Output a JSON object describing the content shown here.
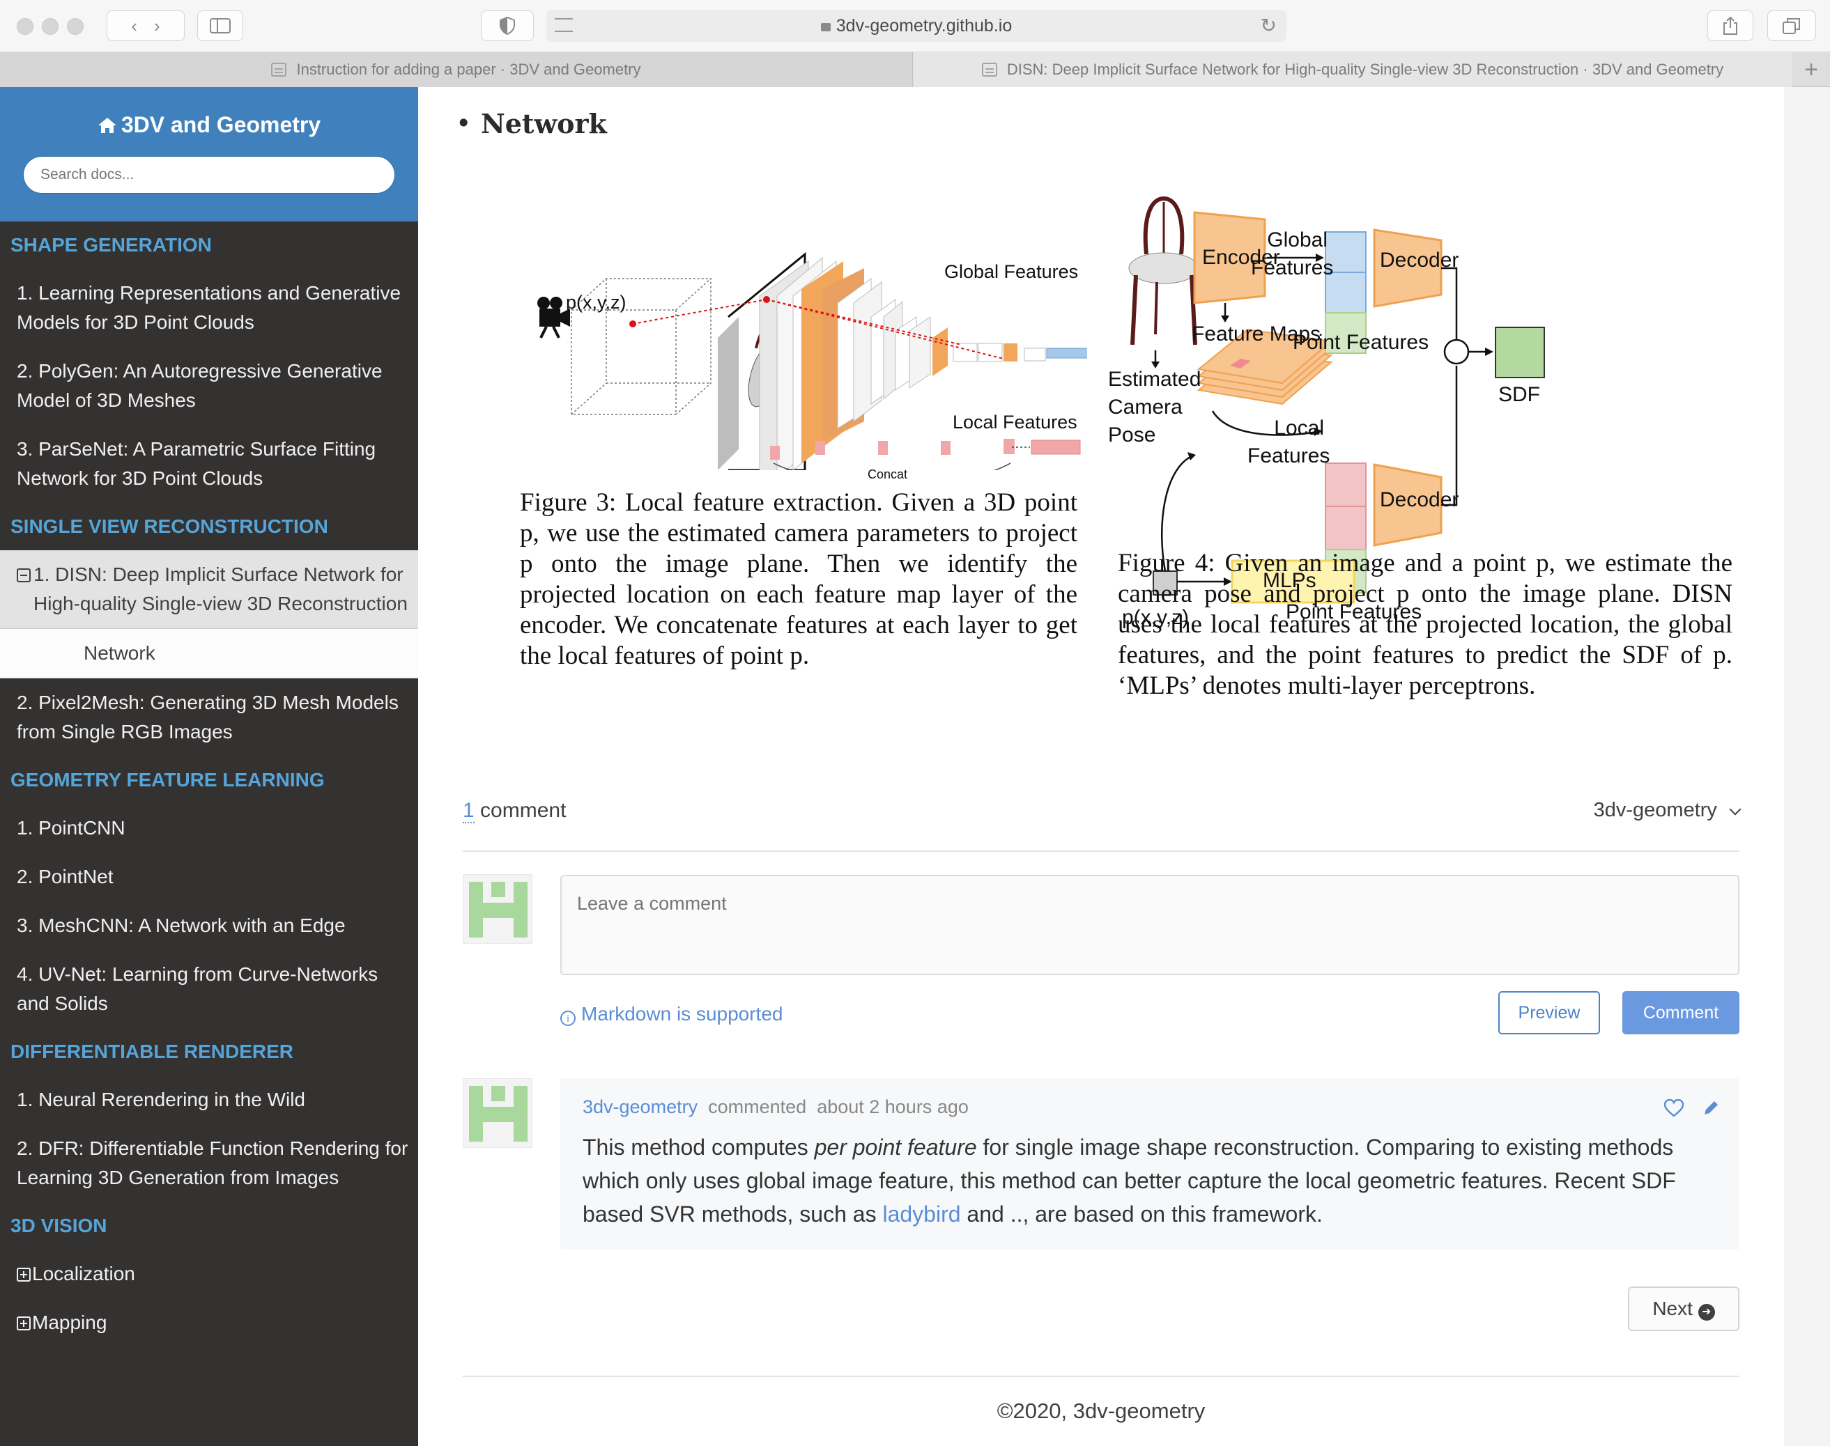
{
  "browser": {
    "url": "3dv-geometry.github.io",
    "tabs": [
      {
        "label": "Instruction for adding a paper · 3DV and Geometry"
      },
      {
        "label": "DISN: Deep Implicit Surface Network for High-quality Single-view 3D Reconstruction · 3DV and Geometry"
      }
    ],
    "new_tab": "+"
  },
  "sidebar": {
    "title": "3DV and Geometry",
    "search_placeholder": "Search docs...",
    "sections": [
      {
        "caption": "SHAPE GENERATION",
        "items": [
          "1. Learning Representations and Generative Models for 3D Point Clouds",
          "2. PolyGen: An Autoregressive Generative Model of 3D Meshes",
          "3. ParSeNet: A Parametric Surface Fitting Network for 3D Point Clouds"
        ]
      },
      {
        "caption": "SINGLE VIEW RECONSTRUCTION",
        "current": "1. DISN: Deep Implicit Surface Network for High-quality Single-view 3D Reconstruction",
        "sub": "Network",
        "items": [
          "2. Pixel2Mesh: Generating 3D Mesh Models from Single RGB Images"
        ]
      },
      {
        "caption": "GEOMETRY FEATURE LEARNING",
        "items": [
          "1. PointCNN",
          "2. PointNet",
          "3. MeshCNN: A Network with an Edge",
          "4. UV-Net: Learning from Curve-Networks and Solids"
        ]
      },
      {
        "caption": "DIFFERENTIABLE RENDERER",
        "items": [
          "1. Neural Rerendering in the Wild",
          "2. DFR: Differentiable Function Rendering for Learning 3D Generation from Images"
        ]
      },
      {
        "caption": "3D VISION",
        "items": [
          "Localization",
          "Mapping"
        ]
      }
    ]
  },
  "content": {
    "heading": "Network",
    "figure3": {
      "labels": {
        "point": "p(x,y,z)",
        "global": "Global Features",
        "local": "Local Features",
        "concat": "Concat"
      },
      "caption": "Figure 3: Local feature extraction. Given a 3D point p, we use the estimated camera parameters to project p onto the image plane. Then we identify the projected location on each feature map layer of the encoder. We concatenate features at each layer to get the local features of point p."
    },
    "figure4": {
      "labels": {
        "global_features": "Global Features",
        "encoder": "Encoder",
        "decoder_top": "Decoder",
        "feature_maps": "Feature Maps",
        "point_features_top": "Point Features",
        "estimated_camera_pose": "Estimated Camera Pose",
        "local_features": "Local Features",
        "decoder_bottom": "Decoder",
        "sdf": "SDF",
        "mlps": "MLPs",
        "point": "p(x,y,z)",
        "point_features_bottom": "Point Features",
        "plus": "+"
      },
      "caption": "Figure 4: Given an image and a point p, we estimate the camera pose and project p onto the image plane. DISN uses the local features at the projected location, the global features, and the point features to predict the SDF of p. ‘MLPs’ denotes multi-layer perceptrons."
    },
    "comments": {
      "count": "1",
      "count_label": "comment",
      "owner": "3dv-geometry",
      "input_placeholder": "Leave a comment",
      "markdown_note": "Markdown is supported",
      "preview_label": "Preview",
      "submit_label": "Comment",
      "items": [
        {
          "author": "3dv-geometry",
          "action": "commented",
          "time": "about 2 hours ago",
          "body_before": "This method computes ",
          "body_em": "per point feature",
          "body_mid": " for single image shape reconstruction. Comparing to existing methods which only uses global image feature, this method can better capture the local geometric features. Recent SDF based SVR methods, such as ",
          "body_link": "ladybird",
          "body_after": " and .., are based on this framework."
        }
      ]
    },
    "next_label": "Next",
    "footer": "©2020, 3dv-geometry"
  },
  "colors": {
    "sidebar_bg": "#343131",
    "sidebar_top": "#3f80bd",
    "caption": "#55a5d9",
    "link": "#5a8dd6",
    "encoder": "#f8c48f",
    "global_feat": "#c5dcf1",
    "local_feat": "#f2c4c6",
    "point_feat": "#d3e8c4",
    "mlp": "#fff3b0",
    "sdf": "#b3d9a0"
  }
}
